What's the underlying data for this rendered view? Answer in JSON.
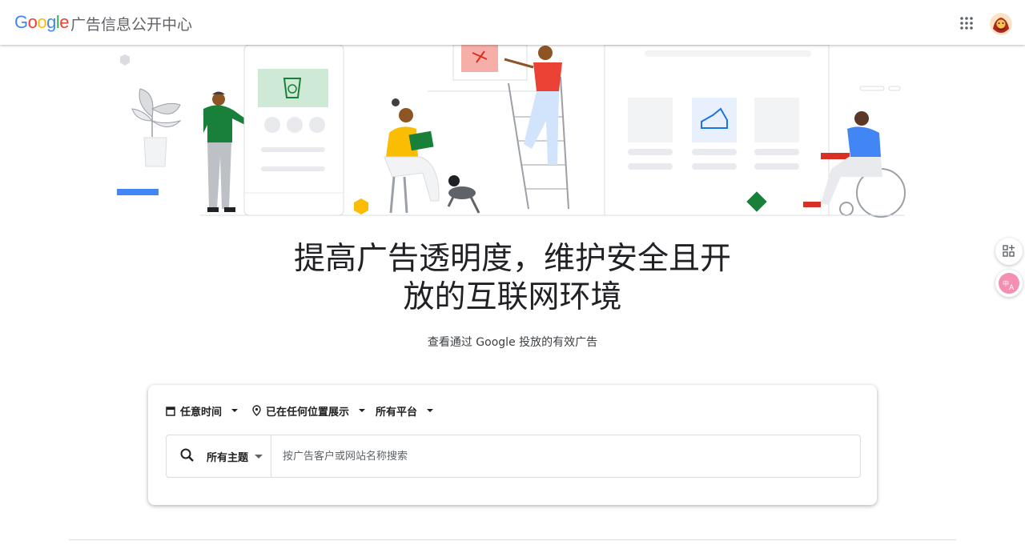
{
  "header": {
    "logo_letters": [
      {
        "ch": "G",
        "color": "#4285F4"
      },
      {
        "ch": "o",
        "color": "#EA4335"
      },
      {
        "ch": "o",
        "color": "#FBBC05"
      },
      {
        "ch": "g",
        "color": "#4285F4"
      },
      {
        "ch": "l",
        "color": "#34A853"
      },
      {
        "ch": "e",
        "color": "#EA4335"
      }
    ],
    "app_title": "广告信息公开中心",
    "apps_icon": "apps-grid-icon",
    "avatar_icon": "account-avatar"
  },
  "hero": {
    "headline_line1": "提高广告透明度，维护安全且开",
    "headline_line2": "放的互联网环境",
    "subtitle": "查看通过 Google 投放的有效广告"
  },
  "search": {
    "filters": [
      {
        "icon": "calendar-icon",
        "label": "任意时间"
      },
      {
        "icon": "location-pin-icon",
        "label": "已在任何位置展示"
      },
      {
        "icon": "",
        "label": "所有平台"
      }
    ],
    "topic_label": "所有主题",
    "placeholder": "按广告客户或网站名称搜索"
  },
  "side_buttons": [
    {
      "icon": "add-widget-icon"
    },
    {
      "icon": "translate-icon"
    }
  ],
  "colors": {
    "google_blue": "#4285F4",
    "google_red": "#EA4335",
    "google_yellow": "#FBBC05",
    "google_green": "#34A853",
    "text_primary": "#202124",
    "text_secondary": "#5f6368"
  }
}
